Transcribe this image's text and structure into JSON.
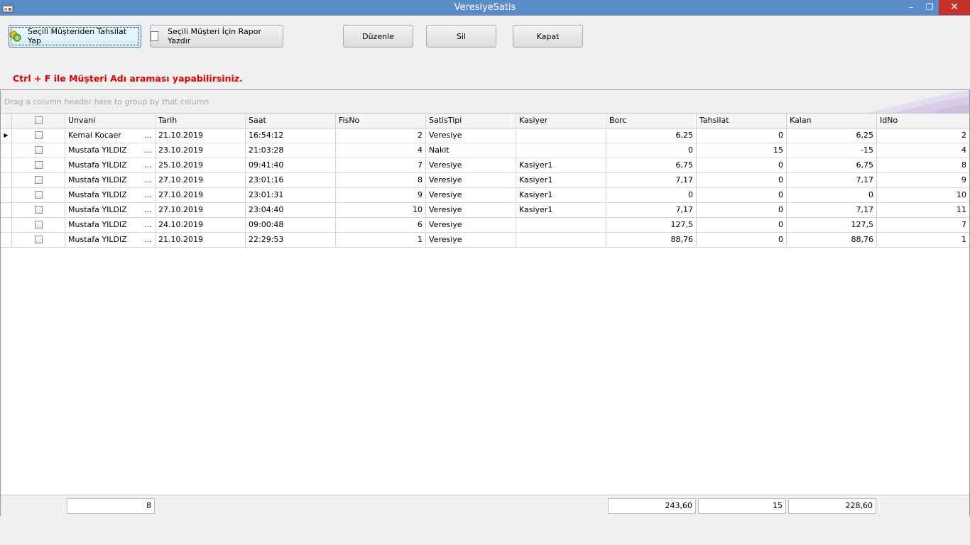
{
  "window": {
    "title": "VeresiyeSatis",
    "minimize": "–",
    "maximize": "❐",
    "close": "✕"
  },
  "toolbar": {
    "tahsilat_label": "Seçili Müşteriden Tahsilat Yap",
    "rapor_label": "Seçili Müşteri İçin Rapor Yazdır",
    "duzenle_label": "Düzenle",
    "sil_label": "Sil",
    "kapat_label": "Kapat"
  },
  "hint": "Ctrl + F ile Müşteri Adı araması yapabilirsiniz.",
  "grid": {
    "group_panel_text": "Drag a column header here to group by that column",
    "columns": [
      "Unvani",
      "Tarih",
      "Saat",
      "FisNo",
      "SatisTipi",
      "Kasiyer",
      "Borc",
      "Tahsilat",
      "Kalan",
      "IdNo"
    ],
    "rows": [
      {
        "unvani": "Kemal Kocaer",
        "tarih": "21.10.2019",
        "saat": "16:54:12",
        "fisno": "2",
        "satistipi": "Veresiye",
        "kasiyer": "",
        "borc": "6,25",
        "tahsilat": "0",
        "kalan": "6,25",
        "idno": "2"
      },
      {
        "unvani": "Mustafa YILDIZ",
        "tarih": "23.10.2019",
        "saat": "21:03:28",
        "fisno": "4",
        "satistipi": "Nakit",
        "kasiyer": "",
        "borc": "0",
        "tahsilat": "15",
        "kalan": "-15",
        "idno": "4"
      },
      {
        "unvani": "Mustafa YILDIZ",
        "tarih": "25.10.2019",
        "saat": "09:41:40",
        "fisno": "7",
        "satistipi": "Veresiye",
        "kasiyer": "Kasiyer1",
        "borc": "6,75",
        "tahsilat": "0",
        "kalan": "6,75",
        "idno": "8"
      },
      {
        "unvani": "Mustafa YILDIZ",
        "tarih": "27.10.2019",
        "saat": "23:01:16",
        "fisno": "8",
        "satistipi": "Veresiye",
        "kasiyer": "Kasiyer1",
        "borc": "7,17",
        "tahsilat": "0",
        "kalan": "7,17",
        "idno": "9"
      },
      {
        "unvani": "Mustafa YILDIZ",
        "tarih": "27.10.2019",
        "saat": "23:01:31",
        "fisno": "9",
        "satistipi": "Veresiye",
        "kasiyer": "Kasiyer1",
        "borc": "0",
        "tahsilat": "0",
        "kalan": "0",
        "idno": "10"
      },
      {
        "unvani": "Mustafa YILDIZ",
        "tarih": "27.10.2019",
        "saat": "23:04:40",
        "fisno": "10",
        "satistipi": "Veresiye",
        "kasiyer": "Kasiyer1",
        "borc": "7,17",
        "tahsilat": "0",
        "kalan": "7,17",
        "idno": "11"
      },
      {
        "unvani": "Mustafa YILDIZ",
        "tarih": "24.10.2019",
        "saat": "09:00:48",
        "fisno": "6",
        "satistipi": "Veresiye",
        "kasiyer": "",
        "borc": "127,5",
        "tahsilat": "0",
        "kalan": "127,5",
        "idno": "7"
      },
      {
        "unvani": "Mustafa YILDIZ",
        "tarih": "21.10.2019",
        "saat": "22:29:53",
        "fisno": "1",
        "satistipi": "Veresiye",
        "kasiyer": "",
        "borc": "88,76",
        "tahsilat": "0",
        "kalan": "88,76",
        "idno": "1"
      }
    ],
    "row_ellipsis": "...",
    "current_row_marker": "▶",
    "footer": {
      "count": "8",
      "borc_total": "243,60",
      "tahsilat_total": "15",
      "kalan_total": "228,60"
    }
  }
}
